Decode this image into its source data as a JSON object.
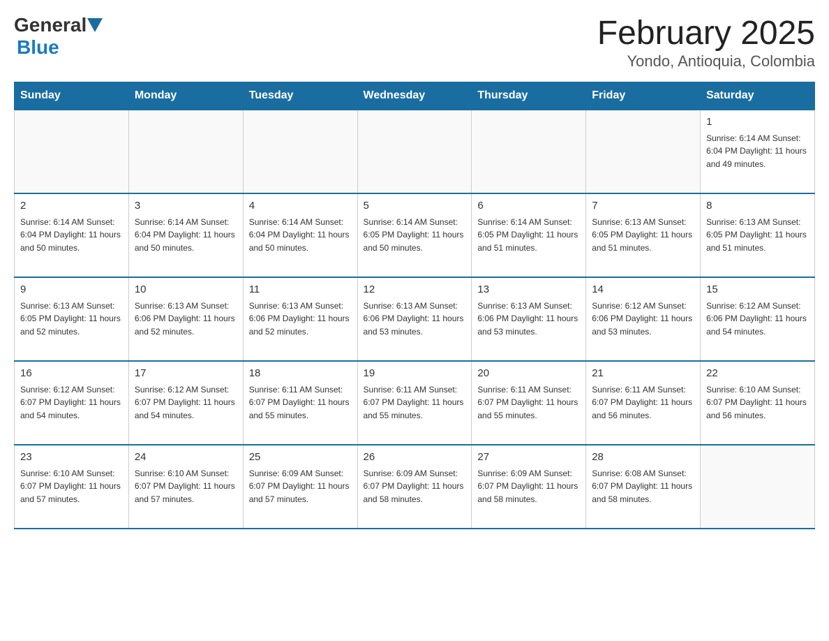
{
  "header": {
    "logo_text_general": "General",
    "logo_text_blue": "Blue",
    "title": "February 2025",
    "subtitle": "Yondo, Antioquia, Colombia"
  },
  "days_of_week": [
    "Sunday",
    "Monday",
    "Tuesday",
    "Wednesday",
    "Thursday",
    "Friday",
    "Saturday"
  ],
  "weeks": [
    [
      {
        "num": "",
        "info": ""
      },
      {
        "num": "",
        "info": ""
      },
      {
        "num": "",
        "info": ""
      },
      {
        "num": "",
        "info": ""
      },
      {
        "num": "",
        "info": ""
      },
      {
        "num": "",
        "info": ""
      },
      {
        "num": "1",
        "info": "Sunrise: 6:14 AM\nSunset: 6:04 PM\nDaylight: 11 hours\nand 49 minutes."
      }
    ],
    [
      {
        "num": "2",
        "info": "Sunrise: 6:14 AM\nSunset: 6:04 PM\nDaylight: 11 hours\nand 50 minutes."
      },
      {
        "num": "3",
        "info": "Sunrise: 6:14 AM\nSunset: 6:04 PM\nDaylight: 11 hours\nand 50 minutes."
      },
      {
        "num": "4",
        "info": "Sunrise: 6:14 AM\nSunset: 6:04 PM\nDaylight: 11 hours\nand 50 minutes."
      },
      {
        "num": "5",
        "info": "Sunrise: 6:14 AM\nSunset: 6:05 PM\nDaylight: 11 hours\nand 50 minutes."
      },
      {
        "num": "6",
        "info": "Sunrise: 6:14 AM\nSunset: 6:05 PM\nDaylight: 11 hours\nand 51 minutes."
      },
      {
        "num": "7",
        "info": "Sunrise: 6:13 AM\nSunset: 6:05 PM\nDaylight: 11 hours\nand 51 minutes."
      },
      {
        "num": "8",
        "info": "Sunrise: 6:13 AM\nSunset: 6:05 PM\nDaylight: 11 hours\nand 51 minutes."
      }
    ],
    [
      {
        "num": "9",
        "info": "Sunrise: 6:13 AM\nSunset: 6:05 PM\nDaylight: 11 hours\nand 52 minutes."
      },
      {
        "num": "10",
        "info": "Sunrise: 6:13 AM\nSunset: 6:06 PM\nDaylight: 11 hours\nand 52 minutes."
      },
      {
        "num": "11",
        "info": "Sunrise: 6:13 AM\nSunset: 6:06 PM\nDaylight: 11 hours\nand 52 minutes."
      },
      {
        "num": "12",
        "info": "Sunrise: 6:13 AM\nSunset: 6:06 PM\nDaylight: 11 hours\nand 53 minutes."
      },
      {
        "num": "13",
        "info": "Sunrise: 6:13 AM\nSunset: 6:06 PM\nDaylight: 11 hours\nand 53 minutes."
      },
      {
        "num": "14",
        "info": "Sunrise: 6:12 AM\nSunset: 6:06 PM\nDaylight: 11 hours\nand 53 minutes."
      },
      {
        "num": "15",
        "info": "Sunrise: 6:12 AM\nSunset: 6:06 PM\nDaylight: 11 hours\nand 54 minutes."
      }
    ],
    [
      {
        "num": "16",
        "info": "Sunrise: 6:12 AM\nSunset: 6:07 PM\nDaylight: 11 hours\nand 54 minutes."
      },
      {
        "num": "17",
        "info": "Sunrise: 6:12 AM\nSunset: 6:07 PM\nDaylight: 11 hours\nand 54 minutes."
      },
      {
        "num": "18",
        "info": "Sunrise: 6:11 AM\nSunset: 6:07 PM\nDaylight: 11 hours\nand 55 minutes."
      },
      {
        "num": "19",
        "info": "Sunrise: 6:11 AM\nSunset: 6:07 PM\nDaylight: 11 hours\nand 55 minutes."
      },
      {
        "num": "20",
        "info": "Sunrise: 6:11 AM\nSunset: 6:07 PM\nDaylight: 11 hours\nand 55 minutes."
      },
      {
        "num": "21",
        "info": "Sunrise: 6:11 AM\nSunset: 6:07 PM\nDaylight: 11 hours\nand 56 minutes."
      },
      {
        "num": "22",
        "info": "Sunrise: 6:10 AM\nSunset: 6:07 PM\nDaylight: 11 hours\nand 56 minutes."
      }
    ],
    [
      {
        "num": "23",
        "info": "Sunrise: 6:10 AM\nSunset: 6:07 PM\nDaylight: 11 hours\nand 57 minutes."
      },
      {
        "num": "24",
        "info": "Sunrise: 6:10 AM\nSunset: 6:07 PM\nDaylight: 11 hours\nand 57 minutes."
      },
      {
        "num": "25",
        "info": "Sunrise: 6:09 AM\nSunset: 6:07 PM\nDaylight: 11 hours\nand 57 minutes."
      },
      {
        "num": "26",
        "info": "Sunrise: 6:09 AM\nSunset: 6:07 PM\nDaylight: 11 hours\nand 58 minutes."
      },
      {
        "num": "27",
        "info": "Sunrise: 6:09 AM\nSunset: 6:07 PM\nDaylight: 11 hours\nand 58 minutes."
      },
      {
        "num": "28",
        "info": "Sunrise: 6:08 AM\nSunset: 6:07 PM\nDaylight: 11 hours\nand 58 minutes."
      },
      {
        "num": "",
        "info": ""
      }
    ]
  ]
}
